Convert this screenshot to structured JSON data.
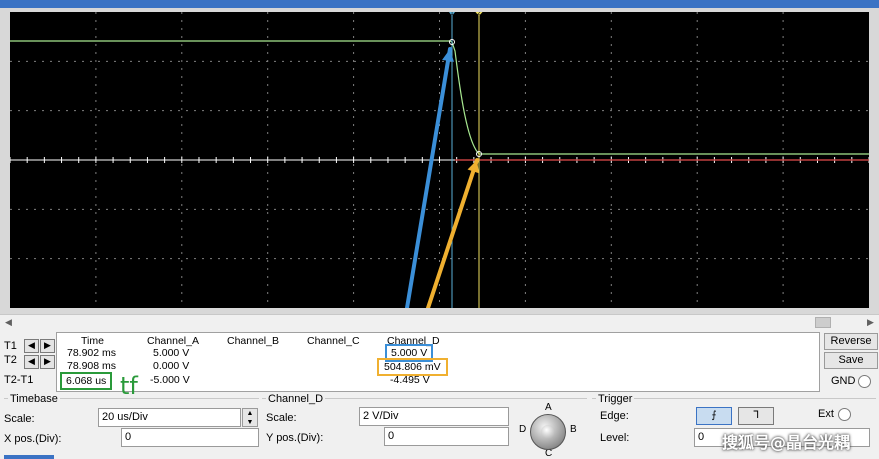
{
  "readout": {
    "headers": [
      "Time",
      "Channel_A",
      "Channel_B",
      "Channel_C",
      "Channel_D"
    ],
    "rows": [
      {
        "label": "T1",
        "time": "78.902 ms",
        "channel_a": "5.000 V",
        "channel_d": "5.000 V"
      },
      {
        "label": "T2",
        "time": "78.908 ms",
        "channel_a": "0.000 V",
        "channel_d": "504.806 mV"
      },
      {
        "label": "T2-T1",
        "time": "6.068 us",
        "channel_a": "-5.000 V",
        "channel_d": "-4.495 V"
      }
    ],
    "annotation": "tf",
    "annotation_color": "#2a9a3a",
    "blue_highlight_color": "#3b8fd8",
    "orange_highlight_color": "#f0b030"
  },
  "buttons": {
    "reverse": "Reverse",
    "save": "Save",
    "gnd": "GND"
  },
  "timebase": {
    "title": "Timebase",
    "scale_label": "Scale:",
    "scale_value": "20 us/Div",
    "xpos_label": "X pos.(Div):",
    "xpos_value": "0"
  },
  "channel_d": {
    "title": "Channel_D",
    "scale_label": "Scale:",
    "scale_value": "2  V/Div",
    "ypos_label": "Y pos.(Div):",
    "ypos_value": "0",
    "knob_labels": [
      "A",
      "B",
      "C",
      "D"
    ]
  },
  "trigger": {
    "title": "Trigger",
    "edge_label": "Edge:",
    "level_label": "Level:",
    "level_value": "0",
    "ext_label": "Ext",
    "edge_falling_glyph": "⨍",
    "edge_rising_glyph": "ᒣ"
  },
  "cursors": {
    "t1_label": "1",
    "t2_label": "2",
    "t1_color": "#5ab0d8",
    "t2_color": "#f0e060"
  },
  "trace": {
    "channel_d_color": "#a8e890",
    "channel_a_color": "#c04040",
    "grid_color": "#808080",
    "axis_color": "#ffffff"
  },
  "watermark": "搜狐号@晶台光耦"
}
